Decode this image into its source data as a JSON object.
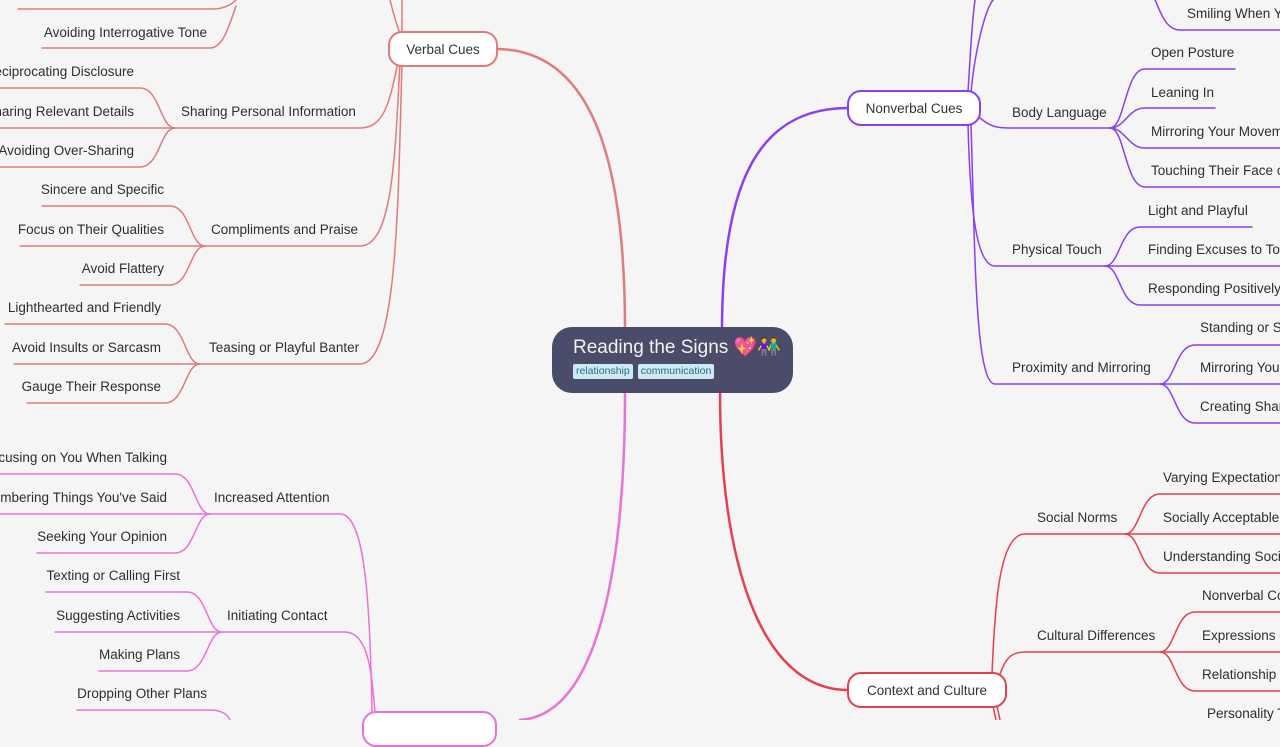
{
  "root": {
    "title": "Reading the Signs 💖👫",
    "tags": [
      "relationship",
      "communication"
    ]
  },
  "colors": {
    "background": "#f5f5f5",
    "root_fill": "#4b4c6a",
    "tag_fill": "#cdeaf5",
    "verbal": "#e07b7b",
    "nonverbal": "#8a3ff0",
    "behavior": "#ea72d6",
    "context": "#e5404f"
  },
  "branches": [
    {
      "label": "Verbal Cues",
      "color_key": "verbal",
      "side": "left",
      "subtopics": [
        {
          "label": "",
          "items": [
            "",
            "Avoiding Interrogative Tone"
          ]
        },
        {
          "label": "Sharing Personal Information",
          "items": [
            "Reciprocating Disclosure",
            "Sharing Relevant Details",
            "Avoiding Over-Sharing"
          ]
        },
        {
          "label": "Compliments and Praise",
          "items": [
            "Sincere and Specific",
            "Focus on Their Qualities",
            "Avoid Flattery"
          ]
        },
        {
          "label": "Teasing or Playful Banter",
          "items": [
            "Lighthearted and Friendly",
            "Avoid Insults or Sarcasm",
            "Gauge Their Response"
          ]
        }
      ]
    },
    {
      "label": "",
      "color_key": "behavior",
      "side": "left",
      "subtopics": [
        {
          "label": "Increased Attention",
          "items": [
            "Focusing on You When Talking",
            "Remembering Things You've Said",
            "Seeking Your Opinion"
          ]
        },
        {
          "label": "Initiating Contact",
          "items": [
            "Texting or Calling First",
            "Suggesting Activities",
            "Making Plans"
          ]
        },
        {
          "label": "",
          "items": [
            "Dropping Other Plans"
          ]
        }
      ]
    },
    {
      "label": "Nonverbal Cues",
      "color_key": "nonverbal",
      "side": "right",
      "subtopics": [
        {
          "label": "",
          "items": [
            "Smiling When Y..."
          ]
        },
        {
          "label": "Body Language",
          "items": [
            "Open Posture",
            "Leaning In",
            "Mirroring Your Movem...",
            "Touching Their Face o..."
          ]
        },
        {
          "label": "Physical Touch",
          "items": [
            "Light and Playful",
            "Finding Excuses to Tou...",
            "Responding Positively..."
          ]
        },
        {
          "label": "Proximity and Mirroring",
          "items": [
            "Standing or S...",
            "Mirroring You...",
            "Creating Shar..."
          ]
        }
      ]
    },
    {
      "label": "Context and Culture",
      "color_key": "context",
      "side": "right",
      "subtopics": [
        {
          "label": "Social Norms",
          "items": [
            "Varying Expectation...",
            "Socially Acceptable...",
            "Understanding Soci..."
          ]
        },
        {
          "label": "Cultural Differences",
          "items": [
            "Nonverbal Co...",
            "Expressions o...",
            "Relationship..."
          ]
        },
        {
          "label": "",
          "items": [
            "Personality T..."
          ]
        }
      ]
    }
  ],
  "visible_labels": {
    "verbal_cues": "Verbal Cues",
    "avoiding_interrogative_tone": "Avoiding Interrogative Tone",
    "sharing_personal_information": "Sharing Personal Information",
    "reciprocating_disclosure": "Reciprocating Disclosure",
    "sharing_relevant_details": "Sharing Relevant Details",
    "avoiding_over_sharing": "Avoiding Over-Sharing",
    "compliments_and_praise": "Compliments and Praise",
    "sincere_and_specific": "Sincere and Specific",
    "focus_on_their_qualities": "Focus on Their Qualities",
    "avoid_flattery": "Avoid Flattery",
    "teasing_or_playful_banter": "Teasing or Playful Banter",
    "lighthearted_and_friendly": "Lighthearted and Friendly",
    "avoid_insults_or_sarcasm": "Avoid Insults or Sarcasm",
    "gauge_their_response": "Gauge Their Response",
    "increased_attention": "Increased Attention",
    "focusing_on_you": "Focusing on You When Talking",
    "remembering_things": "Remembering Things You've Said",
    "seeking_your_opinion": "Seeking Your Opinion",
    "initiating_contact": "Initiating Contact",
    "texting_or_calling_first": "Texting or Calling First",
    "suggesting_activities": "Suggesting Activities",
    "making_plans": "Making Plans",
    "dropping_other_plans": "Dropping Other Plans",
    "nonverbal_cues": "Nonverbal Cues",
    "smiling_when": "Smiling When You",
    "body_language": "Body Language",
    "open_posture": "Open Posture",
    "leaning_in": "Leaning In",
    "mirroring_your_movements": "Mirroring Your Movements",
    "touching_their_face": "Touching Their Face or Hair",
    "physical_touch": "Physical Touch",
    "light_and_playful": "Light and Playful",
    "finding_excuses": "Finding Excuses to Touch",
    "responding_positively": "Responding Positively",
    "proximity_and_mirroring": "Proximity and Mirroring",
    "standing_or_sitting": "Standing or Sitting Close",
    "mirroring_you": "Mirroring Your Actions",
    "creating_shared": "Creating Shared Space",
    "context_and_culture": "Context and Culture",
    "social_norms": "Social Norms",
    "varying_expectations": "Varying Expectations",
    "socially_acceptable": "Socially Acceptable Behavior",
    "understanding_social": "Understanding Social Cues",
    "cultural_differences": "Cultural Differences",
    "nonverbal_co": "Nonverbal Communication",
    "expressions_of": "Expressions of Affection",
    "relationship": "Relationship Norms",
    "personality": "Personality Traits"
  }
}
